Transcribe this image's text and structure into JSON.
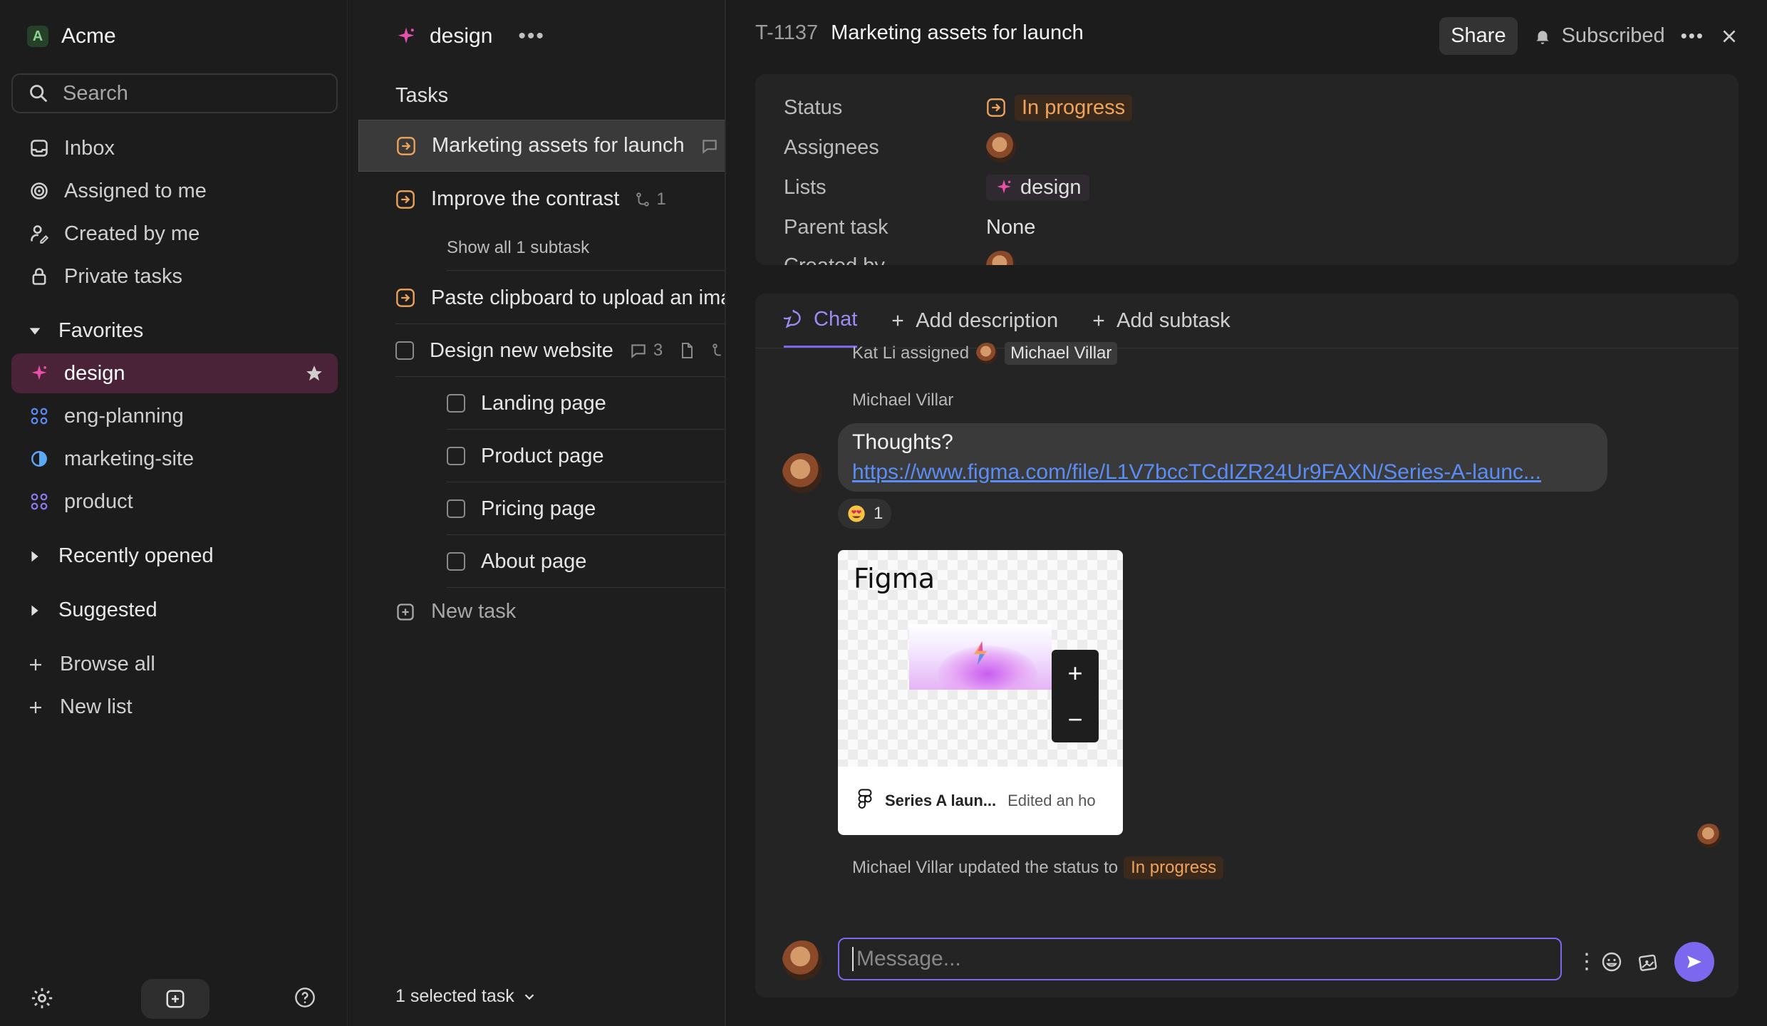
{
  "workspace": {
    "badge": "A",
    "name": "Acme"
  },
  "sidebar": {
    "search_placeholder": "Search",
    "nav": [
      {
        "label": "Inbox",
        "icon": "inbox-icon"
      },
      {
        "label": "Assigned to me",
        "icon": "target-icon"
      },
      {
        "label": "Created by me",
        "icon": "user-pen-icon"
      },
      {
        "label": "Private tasks",
        "icon": "lock-icon"
      }
    ],
    "favorites_label": "Favorites",
    "favorites": [
      {
        "label": "design",
        "icon": "sparkle-icon",
        "active": true
      },
      {
        "label": "eng-planning",
        "icon": "grid-icon"
      },
      {
        "label": "marketing-site",
        "icon": "half-circle-icon"
      },
      {
        "label": "product",
        "icon": "grid-icon"
      }
    ],
    "recently_opened": "Recently opened",
    "suggested": "Suggested",
    "browse_all": "Browse all",
    "new_list": "New list"
  },
  "list": {
    "title": "design",
    "section": "Tasks",
    "tasks": [
      {
        "title": "Marketing assets for launch",
        "selected": true
      },
      {
        "title": "Improve the contrast",
        "subtask_count": "1"
      },
      {
        "title": "Paste clipboard to upload an ima"
      },
      {
        "title": "Design new website",
        "comment_count": "3"
      }
    ],
    "show_subtasks": "Show all 1 subtask",
    "subtasks": [
      "Landing page",
      "Product page",
      "Pricing page",
      "About page"
    ],
    "new_task": "New task",
    "footer": "1 selected task"
  },
  "detail": {
    "id": "T-1137",
    "title": "Marketing assets for launch",
    "share": "Share",
    "subscribed": "Subscribed",
    "props": {
      "status_label": "Status",
      "status_value": "In progress",
      "assignees_label": "Assignees",
      "lists_label": "Lists",
      "lists_value": "design",
      "parent_label": "Parent task",
      "parent_value": "None",
      "created_label": "Created by"
    },
    "tabs": {
      "chat": "Chat",
      "add_description": "Add description",
      "add_subtask": "Add subtask"
    },
    "chat": {
      "assign_prefix": "Kat Li assigned",
      "assign_target": "Michael Villar",
      "sender": "Michael Villar",
      "message_line1": "Thoughts?",
      "message_link": "https://www.figma.com/file/L1V7bccTCdIZR24Ur9FAXN/Series-A-launc...",
      "reaction_count": "1",
      "card_title": "Figma",
      "card_file": "Series A laun...",
      "card_sub": "Edited an ho",
      "status_update_prefix": "Michael Villar updated the status to",
      "status_update_value": "In progress",
      "composer_placeholder": "Message..."
    }
  },
  "colors": {
    "accent": "#7b68ee",
    "status_orange": "#f0a35b",
    "active_fav_bg": "#4a2339"
  }
}
